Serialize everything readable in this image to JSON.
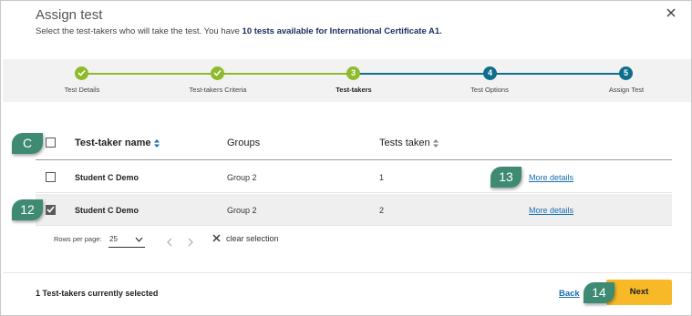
{
  "dialog": {
    "title": "Assign test",
    "subtitle_prefix": "Select the test-takers who will take the test. You have ",
    "subtitle_bold": "10 tests available for International Certificate A1.",
    "close_icon": "close-icon"
  },
  "stepper": {
    "steps": [
      {
        "label": "Test Details",
        "state": "done",
        "number": ""
      },
      {
        "label": "Test-takers Criteria",
        "state": "done",
        "number": ""
      },
      {
        "label": "Test-takers",
        "state": "active",
        "number": "3"
      },
      {
        "label": "Test Options",
        "state": "todo",
        "number": "4"
      },
      {
        "label": "Assign Test",
        "state": "todo",
        "number": "5"
      }
    ],
    "colors": {
      "done": "#8dbb2a",
      "todo": "#0f6e8c"
    }
  },
  "table": {
    "headers": {
      "name": "Test-taker name",
      "groups": "Groups",
      "tests": "Tests taken"
    },
    "rows": [
      {
        "name": "Student C Demo",
        "group": "Group 2",
        "tests": "1",
        "more": "More details",
        "checked": false
      },
      {
        "name": "Student C Demo",
        "group": "Group 2",
        "tests": "2",
        "more": "More details",
        "checked": true
      }
    ]
  },
  "pagination": {
    "rows_per_page_label": "Rows per page:",
    "rows_per_page_value": "25",
    "clear_label": "clear selection"
  },
  "footer": {
    "selected_text": "1 Test-takers currently selected",
    "back_label": "Back",
    "next_label": "Next"
  },
  "callouts": {
    "header_checkbox": "C",
    "row_checkbox": "12",
    "more_details": "13",
    "next_button": "14"
  },
  "colors": {
    "accent": "#f7b928",
    "link": "#1a6fb0",
    "callout": "#3e8a73"
  }
}
